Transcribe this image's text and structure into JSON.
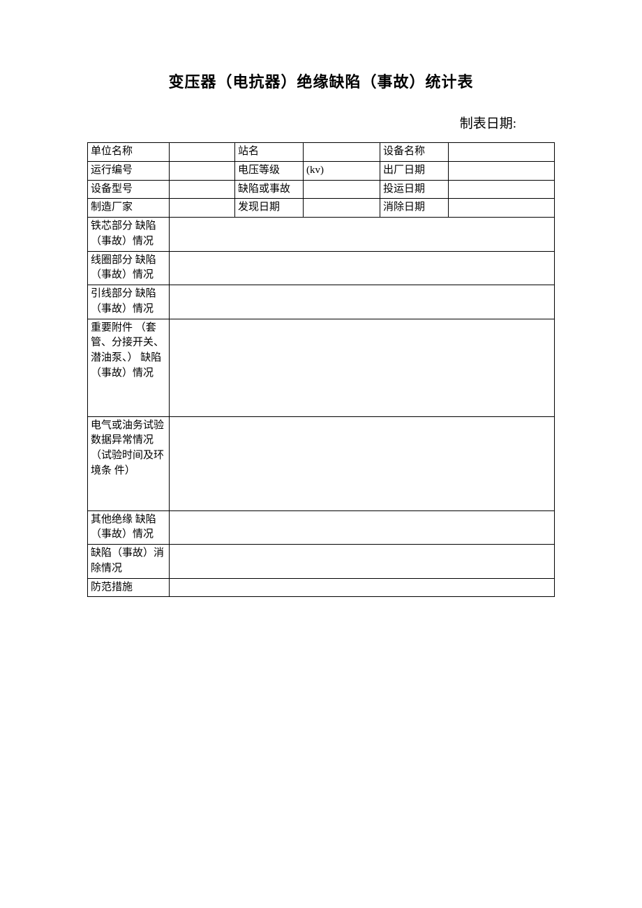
{
  "title": "变压器（电抗器）绝缘缺陷（事故）统计表",
  "date_label": "制表日期:",
  "header_rows": [
    {
      "c1": "单位名称",
      "c2": "",
      "c3": "站名",
      "c4": "",
      "c5": "设备名称",
      "c6": ""
    },
    {
      "c1": "运行编号",
      "c2": "",
      "c3": "电压等级",
      "c4": "(kv)",
      "c5": "出厂日期",
      "c6": ""
    },
    {
      "c1": "设备型号",
      "c2": "",
      "c3": "缺陷或事故",
      "c4": "",
      "c5": "投运日期",
      "c6": ""
    },
    {
      "c1": "制造厂家",
      "c2": "",
      "c3": "发现日期",
      "c4": "",
      "c5": "消除日期",
      "c6": ""
    }
  ],
  "sections": [
    {
      "label": "铁芯部分 缺陷（事故）情况",
      "value": ""
    },
    {
      "label": "线圈部分 缺陷（事故）情况",
      "value": ""
    },
    {
      "label": "引线部分 缺陷（事故）情况",
      "value": ""
    },
    {
      "label": "重要附件 （套管、分接开关、潜油泵、）\n缺陷（事故）情况",
      "value": ""
    },
    {
      "label": "电气或油务试验数据异常情况\n（试验时间及环境条 件）",
      "value": ""
    },
    {
      "label": "其他绝缘 缺陷（事故）情况",
      "value": ""
    },
    {
      "label": "缺陷（事故）消除情况",
      "value": ""
    },
    {
      "label": "防范措施",
      "value": ""
    }
  ]
}
